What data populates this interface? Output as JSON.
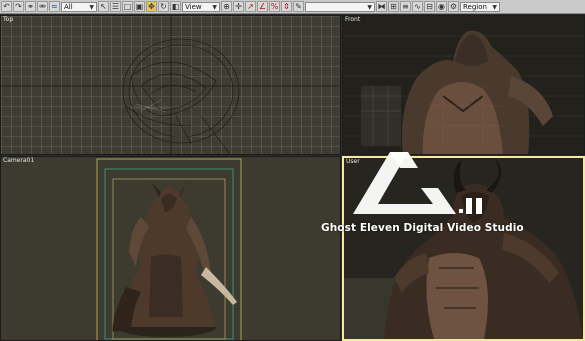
{
  "toolbar": {
    "filter_dropdown": "All",
    "reference_dropdown": "View",
    "named_selection_dropdown": "",
    "selection_region_dropdown": "Region"
  },
  "viewports": {
    "top": "Top",
    "front": "Front",
    "camera": "Camera01",
    "user": "User"
  },
  "watermark": {
    "logo_mark": ".ll",
    "studio_name": "Ghost Eleven Digital Video Studio"
  },
  "colors": {
    "toolbar_bg": "#c9c9c9",
    "viewport_bg": "#3e3d33",
    "grid_line": "#8a8a78",
    "active_viewport_border": "#f5e9a0",
    "safe_frame_yellow": "#c9c060",
    "safe_frame_teal": "#3aa88a"
  }
}
